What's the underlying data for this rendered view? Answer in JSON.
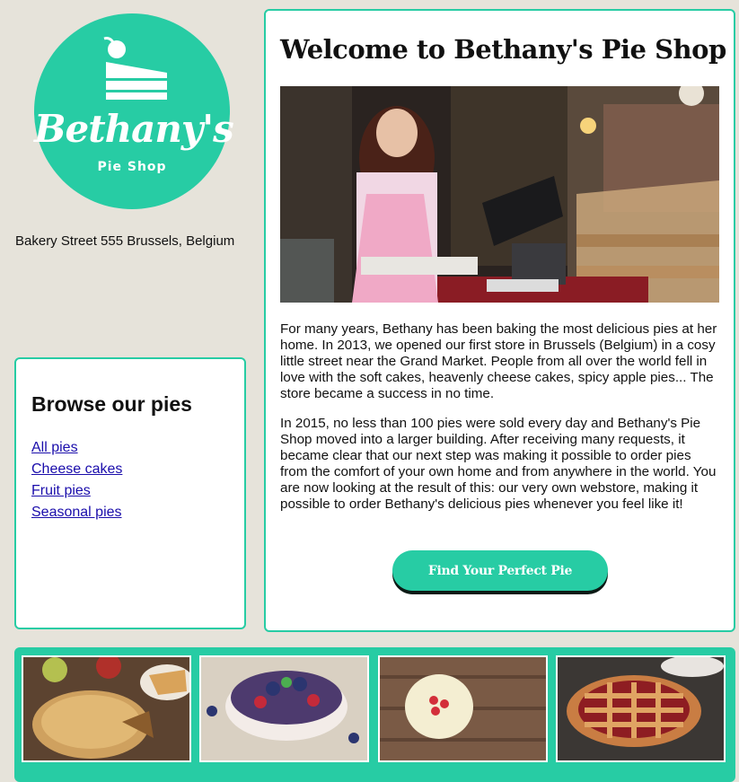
{
  "logo": {
    "brand": "Bethany's",
    "subtitle": "Pie Shop"
  },
  "address": "Bakery Street 555 Brussels, Belgium",
  "browse": {
    "title": "Browse our pies",
    "links": [
      "All pies",
      "Cheese cakes",
      "Fruit pies",
      "Seasonal pies"
    ]
  },
  "main": {
    "title": "Welcome to Bethany's Pie Shop",
    "paragraphs": [
      "For many years, Bethany has been baking the most delicious pies at her home. In 2013, we opened our first store in Brussels (Belgium) in a cosy little street near the Grand Market. People from all over the world fell in love with the soft cakes, heavenly cheese cakes, spicy apple pies... The store became a success in no time.",
      "In 2015, no less than 100 pies were sold every day and Bethany's Pie Shop moved into a larger building. After receiving many requests, it became clear that our next step was making it possible to order pies from the comfort of your own home and from anywhere in the world. You are now looking at the result of this: our very own webstore, making it possible to order Bethany's delicious pies whenever you feel like it!"
    ],
    "cta": "Find Your Perfect Pie"
  },
  "colors": {
    "accent": "#27cca4",
    "background": "#e6e3da",
    "link": "#1a0dab"
  },
  "gallery": [
    "apple-pie-photo",
    "blueberry-cheesecake-photo",
    "strawberry-cheesecake-photo",
    "cherry-lattice-pie-photo"
  ]
}
